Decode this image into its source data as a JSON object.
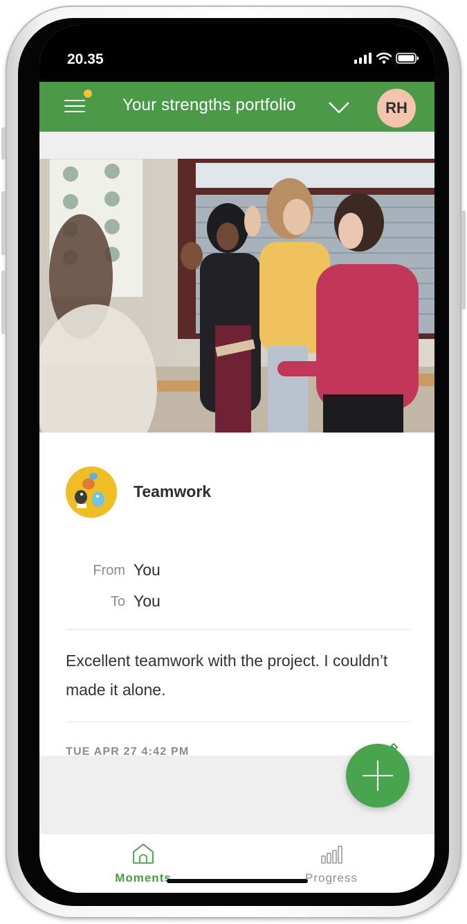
{
  "status_bar": {
    "time": "20.35"
  },
  "header": {
    "title": "Your strengths portfolio",
    "avatar_initials": "RH",
    "colors": {
      "header_bg": "#4a9a49",
      "notification_dot": "#f5c232",
      "avatar_bg": "#f4c4ad"
    }
  },
  "moment": {
    "strength": "Teamwork",
    "from_label": "From",
    "from_value": "You",
    "to_label": "To",
    "to_value": "You",
    "message": "Excellent teamwork with the project. I couldn’t made it alone.",
    "timestamp": "TUE APR 27 4:42 PM"
  },
  "icons": [
    "menu-icon",
    "chevron-down-icon",
    "pencil-icon",
    "plus-icon",
    "home-icon",
    "bar-chart-icon",
    "signal-icon",
    "wifi-icon",
    "battery-icon"
  ],
  "tabs": [
    {
      "label": "Moments",
      "active": true
    },
    {
      "label": "Progress",
      "active": false
    }
  ],
  "colors": {
    "accent": "#49a44f",
    "active_tab": "#4a9a49",
    "inactive_tab": "#8f8f8f"
  }
}
